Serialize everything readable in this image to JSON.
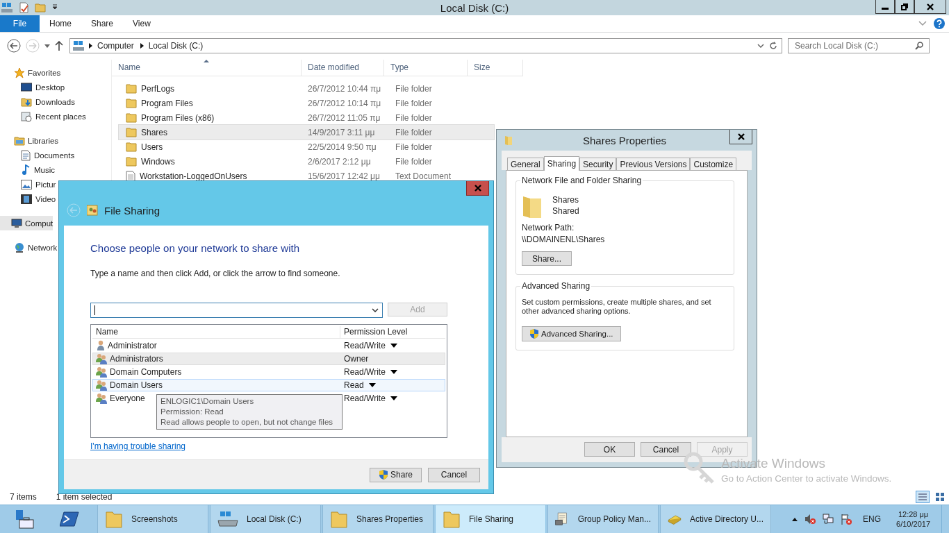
{
  "explorer": {
    "title": "Local Disk (C:)",
    "ribbon_tabs": [
      {
        "label": "File",
        "kind": "file"
      },
      {
        "label": "Home",
        "kind": "tab"
      },
      {
        "label": "Share",
        "kind": "tab"
      },
      {
        "label": "View",
        "kind": "tab"
      }
    ],
    "breadcrumb": [
      "Computer",
      "Local Disk (C:)"
    ],
    "search": {
      "placeholder": "Search Local Disk (C:)"
    },
    "sidebar": [
      {
        "label": "Favorites",
        "kind": "favorites",
        "selected": false,
        "children": [
          {
            "label": "Desktop",
            "kind": "desktop"
          },
          {
            "label": "Downloads",
            "kind": "downloads"
          },
          {
            "label": "Recent places",
            "kind": "recent"
          }
        ]
      },
      {
        "label": "Libraries",
        "kind": "libraries",
        "selected": false,
        "children": [
          {
            "label": "Documents",
            "kind": "documents"
          },
          {
            "label": "Music",
            "kind": "music"
          },
          {
            "label": "Pictur",
            "kind": "pictures"
          },
          {
            "label": "Video",
            "kind": "videos"
          }
        ]
      },
      {
        "label": "Comput",
        "kind": "computer",
        "selected": true
      },
      {
        "label": "Network",
        "kind": "network",
        "selected": false
      }
    ],
    "columns": [
      {
        "label": "Name",
        "sorted": true
      },
      {
        "label": "Date modified",
        "sorted": false
      },
      {
        "label": "Type",
        "sorted": false
      },
      {
        "label": "Size",
        "sorted": false
      }
    ],
    "files": [
      {
        "name": "PerfLogs",
        "date": "26/7/2012 10:44 πμ",
        "type": "File folder",
        "kind": "folder",
        "selected": false
      },
      {
        "name": "Program Files",
        "date": "26/7/2012 10:14 πμ",
        "type": "File folder",
        "kind": "folder",
        "selected": false
      },
      {
        "name": "Program Files (x86)",
        "date": "26/7/2012 11:05 πμ",
        "type": "File folder",
        "kind": "folder",
        "selected": false
      },
      {
        "name": "Shares",
        "date": "14/9/2017 3:11 μμ",
        "type": "File folder",
        "kind": "folder",
        "selected": true
      },
      {
        "name": "Users",
        "date": "22/5/2014 9:50 πμ",
        "type": "File folder",
        "kind": "folder",
        "selected": false
      },
      {
        "name": "Windows",
        "date": "2/6/2017 2:12 μμ",
        "type": "File folder",
        "kind": "folder",
        "selected": false
      },
      {
        "name": "Workstation-LoggedOnUsers",
        "date": "15/6/2017 12:42 μμ",
        "type": "Text Document",
        "kind": "text",
        "selected": false
      }
    ],
    "status": {
      "count": "7 items",
      "selection": "1 item selected"
    }
  },
  "file_sharing": {
    "title": "File Sharing",
    "heading": "Choose people on your network to share with",
    "instruction": "Type a name and then click Add, or click the arrow to find someone.",
    "add_button": {
      "label": "Add",
      "disabled": true
    },
    "columns": [
      "Name",
      "Permission Level"
    ],
    "people": [
      {
        "name": "Administrator",
        "permission": "Read/Write",
        "kind": "user",
        "menu": true,
        "selected": false,
        "hovered": false
      },
      {
        "name": "Administrators",
        "permission": "Owner",
        "kind": "group",
        "menu": false,
        "selected": true,
        "hovered": false
      },
      {
        "name": "Domain Computers",
        "permission": "Read/Write",
        "kind": "group",
        "menu": true,
        "selected": false,
        "hovered": false
      },
      {
        "name": "Domain Users",
        "permission": "Read",
        "kind": "group",
        "menu": true,
        "selected": false,
        "hovered": true
      },
      {
        "name": "Everyone",
        "permission": "Read/Write",
        "kind": "group",
        "menu": true,
        "selected": false,
        "hovered": false
      }
    ],
    "tooltip": [
      "ENLOGIC1\\Domain Users",
      "Permission: Read",
      "Read allows people to open, but not change files"
    ],
    "link": "I'm having trouble sharing",
    "buttons": [
      {
        "label": "Share",
        "shield": true
      },
      {
        "label": "Cancel",
        "shield": false
      }
    ]
  },
  "properties": {
    "title": "Shares Properties",
    "tabs": [
      {
        "label": "General",
        "selected": false
      },
      {
        "label": "Sharing",
        "selected": true
      },
      {
        "label": "Security",
        "selected": false
      },
      {
        "label": "Previous Versions",
        "selected": false
      },
      {
        "label": "Customize",
        "selected": false
      }
    ],
    "network_group": {
      "title": "Network File and Folder Sharing",
      "folder": "Shares",
      "state": "Shared",
      "path_label": "Network Path:",
      "path": "\\\\DOMAINENL\\Shares",
      "button": "Share..."
    },
    "advanced_group": {
      "title": "Advanced Sharing",
      "description": "Set custom permissions, create multiple shares, and set other advanced sharing options.",
      "button": "Advanced Sharing..."
    },
    "buttons": [
      {
        "label": "OK",
        "disabled": false
      },
      {
        "label": "Cancel",
        "disabled": false
      },
      {
        "label": "Apply",
        "disabled": true
      }
    ]
  },
  "activation": {
    "title": "Activate Windows",
    "subtitle": "Go to Action Center to activate Windows."
  },
  "taskbar": {
    "items": [
      {
        "label": "Screenshots",
        "kind": "folder",
        "selected": false
      },
      {
        "label": "Local Disk (C:)",
        "kind": "drive",
        "selected": false
      },
      {
        "label": "Shares Properties",
        "kind": "folder",
        "selected": false
      },
      {
        "label": "File Sharing",
        "kind": "folder",
        "selected": true
      },
      {
        "label": "Group Policy Man...",
        "kind": "policy",
        "selected": false
      },
      {
        "label": "Active Directory U...",
        "kind": "directory",
        "selected": false
      }
    ],
    "language": "ENG",
    "time": "12:28 μμ",
    "date": "6/10/2017"
  }
}
